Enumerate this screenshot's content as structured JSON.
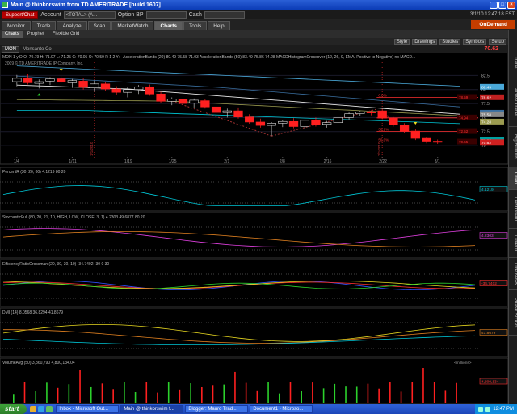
{
  "window": {
    "title": "Main @ thinkorswim from TD AMERITRADE [build 1607]",
    "controls": [
      "_",
      "□",
      "×"
    ]
  },
  "account_bar": {
    "support_label": "Support/Chat",
    "account_label": "Account",
    "account_value": "<TOTAL> (A...",
    "option_bp_label": "Option BP",
    "cash_label": "Cash",
    "datetime": "3/1/10 12:47:18 EST"
  },
  "nav": {
    "tabs": [
      "Monitor",
      "Trade",
      "Analyze",
      "Scan",
      "MarketWatch",
      "Charts",
      "Tools",
      "Help"
    ],
    "active": "Charts",
    "ondemand_label": "OnDemand"
  },
  "subtabs": {
    "items": [
      "Charts",
      "Prophet",
      "Flexible Grid"
    ],
    "active": "Charts"
  },
  "toolbar": {
    "symbols_label": "Symbols",
    "setup_label": "Setup",
    "style_label": "Style",
    "drawings_label": "Drawings",
    "studies_label": "Studies"
  },
  "symbol": {
    "ticker": "MON",
    "description": "Monsanto Co",
    "last_price": "70.62"
  },
  "colors": {
    "up_candle": "#2cd12c",
    "down_candle": "#ff2020",
    "sma": "#e8e8e8",
    "band_upper": "#4aa8d8",
    "fib_red": "#ff3030",
    "cyan": "#00c8d8",
    "magenta": "#e040e0",
    "yellow": "#e8d820",
    "orange": "#e08020",
    "blue": "#3050ff"
  },
  "price_panel": {
    "header": "MON 1 y D  O: 70.79  H: 71.07  L: 71.25  C: 70.05  O: 70.59  R 1 2  Y: -   AccelerationBands (20) 80.49 75.58 71.03  AccelerationBands (50) 83.49 75.86 74.28  MACDHistogramCrossover (12, 26, 9, EMA, Positive to Negative) no  MACD...",
    "copyright": "2009 © TD AMERITRADE IP Company, Inc.",
    "y_labels": [
      "82.5",
      "80",
      "77.5",
      "75",
      "72.5",
      "70"
    ],
    "x_dates": [
      "1/4",
      "1/11",
      "1/19",
      "1/25",
      "2/1",
      "2/8",
      "2/16",
      "2/22",
      "3/1",
      "3/8"
    ],
    "fib_labels": [
      "0.0%",
      "23.6%",
      "38.2%",
      "50.0%"
    ],
    "fib_values": [
      "78.59",
      "74.94",
      "72.52",
      "70.65"
    ],
    "price_tags": [
      "80.49",
      "78.62",
      "75.86",
      "75.58",
      "74.28",
      "71.03",
      "70.62"
    ],
    "date_markers": [
      "1/1/2010",
      "2/1/2010"
    ],
    "chart_data": {
      "type": "candlestick",
      "ylim": [
        69,
        84
      ],
      "categories": [
        "1/4",
        "1/5",
        "1/6",
        "1/7",
        "1/8",
        "1/11",
        "1/12",
        "1/13",
        "1/14",
        "1/15",
        "1/19",
        "1/20",
        "1/21",
        "1/22",
        "1/25",
        "1/26",
        "1/27",
        "1/28",
        "1/29",
        "2/1",
        "2/2",
        "2/3",
        "2/4",
        "2/5",
        "2/8",
        "2/9",
        "2/10",
        "2/11",
        "2/12",
        "2/16",
        "2/17",
        "2/18",
        "2/19",
        "2/22",
        "2/23",
        "2/24",
        "2/25",
        "2/26",
        "3/1"
      ],
      "candles": [
        {
          "o": 81.4,
          "h": 82.6,
          "l": 80.6,
          "c": 82.0
        },
        {
          "o": 82.0,
          "h": 82.8,
          "l": 80.9,
          "c": 81.2
        },
        {
          "o": 81.1,
          "h": 81.8,
          "l": 80.2,
          "c": 81.4
        },
        {
          "o": 81.5,
          "h": 82.2,
          "l": 80.8,
          "c": 81.9
        },
        {
          "o": 81.9,
          "h": 82.4,
          "l": 81.1,
          "c": 81.3
        },
        {
          "o": 81.2,
          "h": 81.9,
          "l": 80.3,
          "c": 81.6
        },
        {
          "o": 81.5,
          "h": 82.0,
          "l": 80.0,
          "c": 80.4
        },
        {
          "o": 80.3,
          "h": 81.6,
          "l": 79.6,
          "c": 81.0
        },
        {
          "o": 81.0,
          "h": 81.4,
          "l": 79.8,
          "c": 80.1
        },
        {
          "o": 80.1,
          "h": 80.6,
          "l": 79.1,
          "c": 79.5
        },
        {
          "o": 79.5,
          "h": 80.4,
          "l": 78.6,
          "c": 80.0
        },
        {
          "o": 80.0,
          "h": 80.8,
          "l": 79.2,
          "c": 80.5
        },
        {
          "o": 80.5,
          "h": 80.9,
          "l": 78.9,
          "c": 79.2
        },
        {
          "o": 79.2,
          "h": 79.6,
          "l": 77.6,
          "c": 77.9
        },
        {
          "o": 77.9,
          "h": 78.6,
          "l": 77.2,
          "c": 78.3
        },
        {
          "o": 78.3,
          "h": 78.8,
          "l": 77.0,
          "c": 77.5
        },
        {
          "o": 77.6,
          "h": 78.4,
          "l": 76.8,
          "c": 78.1
        },
        {
          "o": 78.0,
          "h": 78.3,
          "l": 76.6,
          "c": 76.9
        },
        {
          "o": 76.9,
          "h": 77.2,
          "l": 75.6,
          "c": 75.9
        },
        {
          "o": 75.9,
          "h": 76.6,
          "l": 75.0,
          "c": 76.2
        },
        {
          "o": 76.2,
          "h": 76.8,
          "l": 74.8,
          "c": 75.1
        },
        {
          "o": 75.1,
          "h": 75.6,
          "l": 73.9,
          "c": 74.2
        },
        {
          "o": 74.2,
          "h": 74.8,
          "l": 73.2,
          "c": 73.6
        },
        {
          "o": 73.6,
          "h": 74.2,
          "l": 71.7,
          "c": 74.0
        },
        {
          "o": 74.0,
          "h": 74.6,
          "l": 73.3,
          "c": 74.3
        },
        {
          "o": 74.3,
          "h": 74.9,
          "l": 73.1,
          "c": 73.4
        },
        {
          "o": 73.4,
          "h": 74.6,
          "l": 73.0,
          "c": 74.5
        },
        {
          "o": 74.5,
          "h": 75.0,
          "l": 73.4,
          "c": 73.8
        },
        {
          "o": 73.8,
          "h": 74.4,
          "l": 73.2,
          "c": 74.1
        },
        {
          "o": 74.1,
          "h": 75.2,
          "l": 73.8,
          "c": 75.0
        },
        {
          "o": 75.0,
          "h": 75.9,
          "l": 74.6,
          "c": 75.7
        },
        {
          "o": 75.7,
          "h": 76.2,
          "l": 75.3,
          "c": 76.0
        },
        {
          "o": 76.0,
          "h": 76.3,
          "l": 75.4,
          "c": 75.9
        },
        {
          "o": 76.2,
          "h": 76.5,
          "l": 74.7,
          "c": 74.9
        },
        {
          "o": 74.9,
          "h": 75.1,
          "l": 73.4,
          "c": 73.7
        },
        {
          "o": 73.7,
          "h": 74.0,
          "l": 72.3,
          "c": 72.6
        },
        {
          "o": 72.6,
          "h": 72.9,
          "l": 71.0,
          "c": 71.3
        },
        {
          "o": 71.3,
          "h": 71.6,
          "l": 70.4,
          "c": 70.8
        },
        {
          "o": 70.8,
          "h": 71.1,
          "l": 70.3,
          "c": 70.6
        }
      ]
    }
  },
  "indicators": [
    {
      "key": "percentr",
      "header": "PercentR (30, 20, 80)  4.1219  80  20",
      "label": "4.1219",
      "label_color": "#00c8d8"
    },
    {
      "key": "stoch",
      "header": "StochasticFull (80, 20, 21, 10, HIGH, LOW, CLOSE, 3, 1)  4.2303  49.6877  80  20",
      "label": "4.2303",
      "label_color": "#e040e0"
    },
    {
      "key": "effratio",
      "header": "EfficiencyRatioGrossman (20, 30, 30, 10)  -34.7402  -30  0  30",
      "label": "-34.7402",
      "label_color": "#ff3030"
    },
    {
      "key": "dmi",
      "header": "DMI (14)  8.0568  36.8294  41.8679",
      "label": "41.8679",
      "label_color": "#e08020"
    },
    {
      "key": "volume",
      "header": "VolumeAvg (50)  3,860,790  4,800,134.04",
      "label": "4,800,134",
      "label_color": "#ff3030",
      "units": "<millions>"
    }
  ],
  "sidebar": {
    "tabs": [
      "Trade",
      "Active Trader",
      "Big Buttons",
      "Chart",
      "Dashboard",
      "Level II",
      "Live News",
      "Phase Scores"
    ],
    "active": "Chart"
  },
  "taskbar": {
    "start_label": "start",
    "tasks": [
      "Inbox - Microsoft Out...",
      "Main @ thinkorswim f...",
      "Blogger: Mauro Tradi...",
      "Document1 - Microso..."
    ],
    "active_task": "Main @ thinkorswim f...",
    "clock": "12:47 PM"
  }
}
